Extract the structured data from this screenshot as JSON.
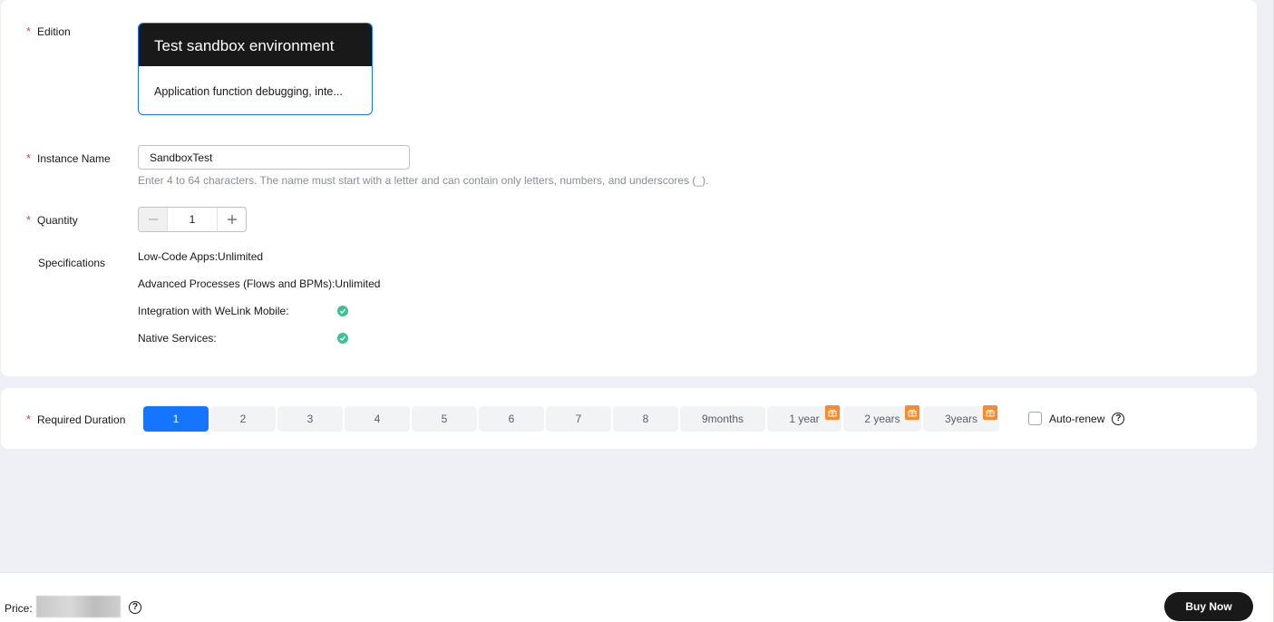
{
  "form": {
    "edition": {
      "label": "Edition",
      "card_title": "Test sandbox environment",
      "card_desc": "Application function debugging, inte..."
    },
    "instance_name": {
      "label": "Instance Name",
      "value": "SandboxTest",
      "hint": "Enter 4 to 64 characters. The name must start with a letter and can contain only letters, numbers, and underscores (_)."
    },
    "quantity": {
      "label": "Quantity",
      "value": "1",
      "minus_icon": "minus-icon",
      "plus_icon": "plus-icon"
    },
    "specifications": {
      "label": "Specifications",
      "lines": [
        "Low-Code Apps:Unlimited",
        "Advanced Processes (Flows and BPMs):Unlimited",
        "Integration with WeLink Mobile:",
        "Native Services:"
      ],
      "check_icon": "check-circle-icon",
      "check_color": "#3ac295"
    }
  },
  "duration": {
    "label": "Required Duration",
    "options": [
      "1",
      "2",
      "3",
      "4",
      "5",
      "6",
      "7",
      "8",
      "9months",
      "1 year",
      "2 years",
      "3years"
    ],
    "selected": "1",
    "gift_icon": "gift-icon",
    "auto_renew_label": "Auto-renew",
    "auto_renew_checked": false
  },
  "footer": {
    "price_label": "Price:",
    "buy_label": "Buy Now"
  },
  "colors": {
    "accent": "#1476ff",
    "required": "#e6414d",
    "gift": "#f88a2e",
    "dark": "#191919"
  }
}
